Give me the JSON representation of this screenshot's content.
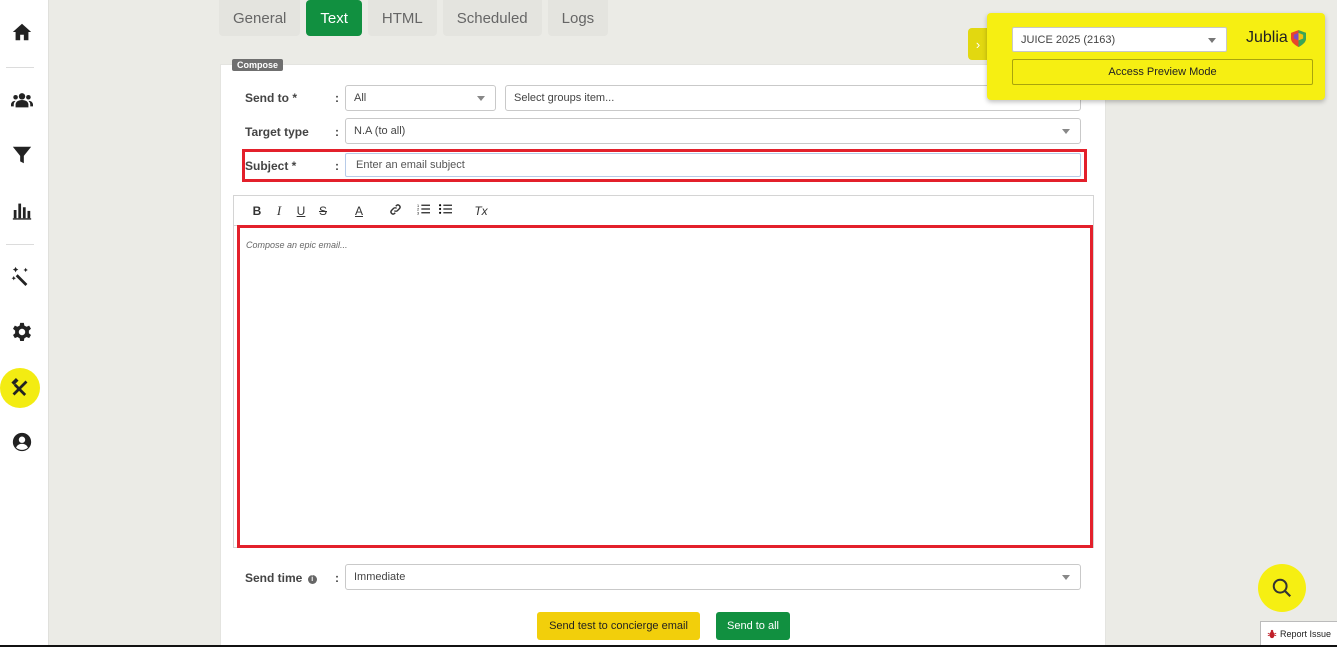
{
  "tabs": [
    {
      "label": "General"
    },
    {
      "label": "Text"
    },
    {
      "label": "HTML"
    },
    {
      "label": "Scheduled"
    },
    {
      "label": "Logs"
    }
  ],
  "active_tab": "Text",
  "compose_label": "Compose",
  "form": {
    "send_to_label": "Send to *",
    "send_to_value": "All",
    "groups_placeholder": "Select groups item...",
    "target_type_label": "Target type",
    "target_type_value": "N.A (to all)",
    "subject_label": "Subject *",
    "subject_placeholder": "Enter an email subject",
    "colon": ":",
    "editor_placeholder": "Compose an epic email...",
    "send_time_label": "Send time",
    "send_time_value": "Immediate",
    "info_glyph": "i"
  },
  "toolbar": {
    "bold": "B",
    "italic": "I",
    "underline": "U",
    "strike": "S",
    "color": "A",
    "clear": "Tx"
  },
  "buttons": {
    "send_test": "Send test to concierge email",
    "send_all": "Send to all"
  },
  "preview": {
    "event_value": "JUICE 2025 (2163)",
    "access_preview": "Access Preview Mode",
    "logo_text": "Jublia"
  },
  "report_issue": "Report Issue",
  "colors": {
    "accent_green": "#119040",
    "accent_yellow": "#f6ef12",
    "highlight_red": "#e3202b"
  },
  "sidebar_icons": [
    "home-icon",
    "users-icon",
    "filter-icon",
    "bar-chart-icon",
    "magic-wand-icon",
    "gear-icon",
    "tools-icon",
    "account-icon"
  ]
}
